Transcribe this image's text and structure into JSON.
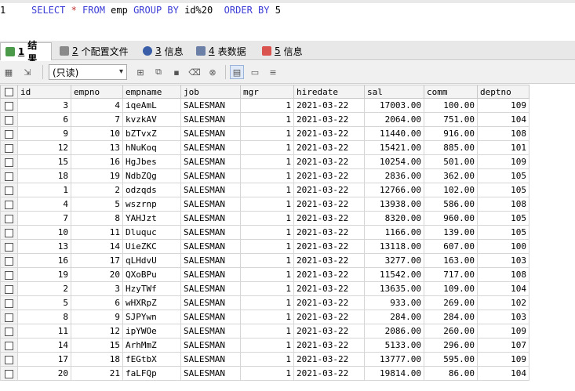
{
  "editor": {
    "line_number": "1",
    "sql_parts": [
      "SELECT",
      " * ",
      "FROM",
      " emp ",
      "GROUP BY",
      " id%20  ",
      "ORDER BY",
      " 5"
    ]
  },
  "tabs": [
    {
      "num": "1",
      "label": "结果",
      "active": true
    },
    {
      "num": "2",
      "label": "个配置文件"
    },
    {
      "num": "3",
      "label": "信息"
    },
    {
      "num": "4",
      "label": "表数据"
    },
    {
      "num": "5",
      "label": "信息"
    }
  ],
  "toolbar": {
    "mode": "(只读)"
  },
  "columns": [
    "id",
    "empno",
    "empname",
    "job",
    "mgr",
    "hiredate",
    "sal",
    "comm",
    "deptno"
  ],
  "rows": [
    [
      "3",
      "4",
      "iqeAmL",
      "SALESMAN",
      "1",
      "2021-03-22",
      "17003.00",
      "100.00",
      "109"
    ],
    [
      "6",
      "7",
      "kvzkAV",
      "SALESMAN",
      "1",
      "2021-03-22",
      "2064.00",
      "751.00",
      "104"
    ],
    [
      "9",
      "10",
      "bZTvxZ",
      "SALESMAN",
      "1",
      "2021-03-22",
      "11440.00",
      "916.00",
      "108"
    ],
    [
      "12",
      "13",
      "hNuKoq",
      "SALESMAN",
      "1",
      "2021-03-22",
      "15421.00",
      "885.00",
      "101"
    ],
    [
      "15",
      "16",
      "HgJbes",
      "SALESMAN",
      "1",
      "2021-03-22",
      "10254.00",
      "501.00",
      "109"
    ],
    [
      "18",
      "19",
      "NdbZQg",
      "SALESMAN",
      "1",
      "2021-03-22",
      "2836.00",
      "362.00",
      "105"
    ],
    [
      "1",
      "2",
      "odzqds",
      "SALESMAN",
      "1",
      "2021-03-22",
      "12766.00",
      "102.00",
      "105"
    ],
    [
      "4",
      "5",
      "wszrnp",
      "SALESMAN",
      "1",
      "2021-03-22",
      "13938.00",
      "586.00",
      "108"
    ],
    [
      "7",
      "8",
      "YAHJzt",
      "SALESMAN",
      "1",
      "2021-03-22",
      "8320.00",
      "960.00",
      "105"
    ],
    [
      "10",
      "11",
      "Dluquc",
      "SALESMAN",
      "1",
      "2021-03-22",
      "1166.00",
      "139.00",
      "105"
    ],
    [
      "13",
      "14",
      "UieZKC",
      "SALESMAN",
      "1",
      "2021-03-22",
      "13118.00",
      "607.00",
      "100"
    ],
    [
      "16",
      "17",
      "qLHdvU",
      "SALESMAN",
      "1",
      "2021-03-22",
      "3277.00",
      "163.00",
      "103"
    ],
    [
      "19",
      "20",
      "QXoBPu",
      "SALESMAN",
      "1",
      "2021-03-22",
      "11542.00",
      "717.00",
      "108"
    ],
    [
      "2",
      "3",
      "HzyTWf",
      "SALESMAN",
      "1",
      "2021-03-22",
      "13635.00",
      "109.00",
      "104"
    ],
    [
      "5",
      "6",
      "wHXRpZ",
      "SALESMAN",
      "1",
      "2021-03-22",
      "933.00",
      "269.00",
      "102"
    ],
    [
      "8",
      "9",
      "SJPYwn",
      "SALESMAN",
      "1",
      "2021-03-22",
      "284.00",
      "284.00",
      "103"
    ],
    [
      "11",
      "12",
      "ipYWOe",
      "SALESMAN",
      "1",
      "2021-03-22",
      "2086.00",
      "260.00",
      "109"
    ],
    [
      "14",
      "15",
      "ArhMmZ",
      "SALESMAN",
      "1",
      "2021-03-22",
      "5133.00",
      "296.00",
      "107"
    ],
    [
      "17",
      "18",
      "fEGtbX",
      "SALESMAN",
      "1",
      "2021-03-22",
      "13777.00",
      "595.00",
      "109"
    ],
    [
      "20",
      "21",
      "faLFQp",
      "SALESMAN",
      "1",
      "2021-03-22",
      "19814.00",
      "86.00",
      "104"
    ]
  ]
}
